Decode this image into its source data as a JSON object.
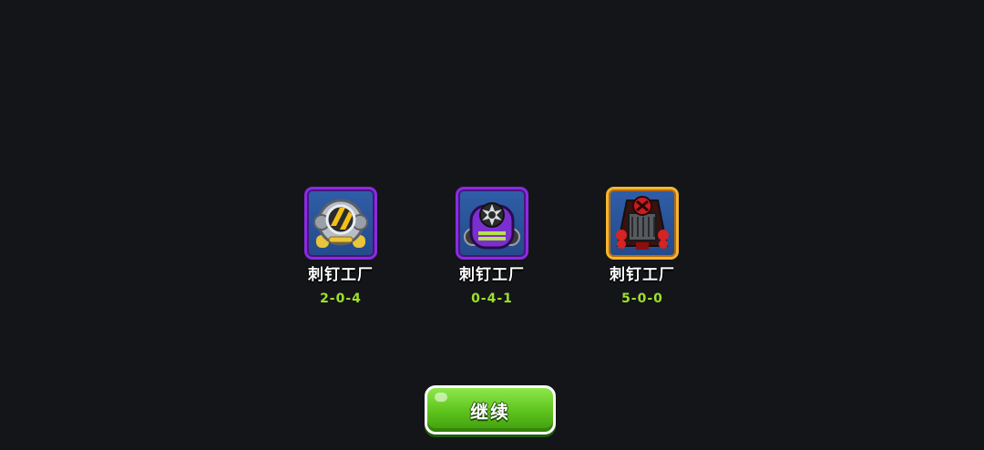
{
  "towers": [
    {
      "name": "刺钉工厂",
      "path": "2-0-4",
      "icon": "spike-factory-icon",
      "frame": "purple"
    },
    {
      "name": "刺钉工厂",
      "path": "0-4-1",
      "icon": "spike-factory-icon",
      "frame": "purple"
    },
    {
      "name": "刺钉工厂",
      "path": "5-0-0",
      "icon": "spike-factory-icon",
      "frame": "gold"
    }
  ],
  "continue_button": {
    "label": "继续"
  },
  "colors": {
    "background": "#141518",
    "path_text": "#9ee02a",
    "frame_purple": "#8a2be2",
    "frame_gold": "#f5b52e",
    "button_green": "#5cc21c"
  }
}
